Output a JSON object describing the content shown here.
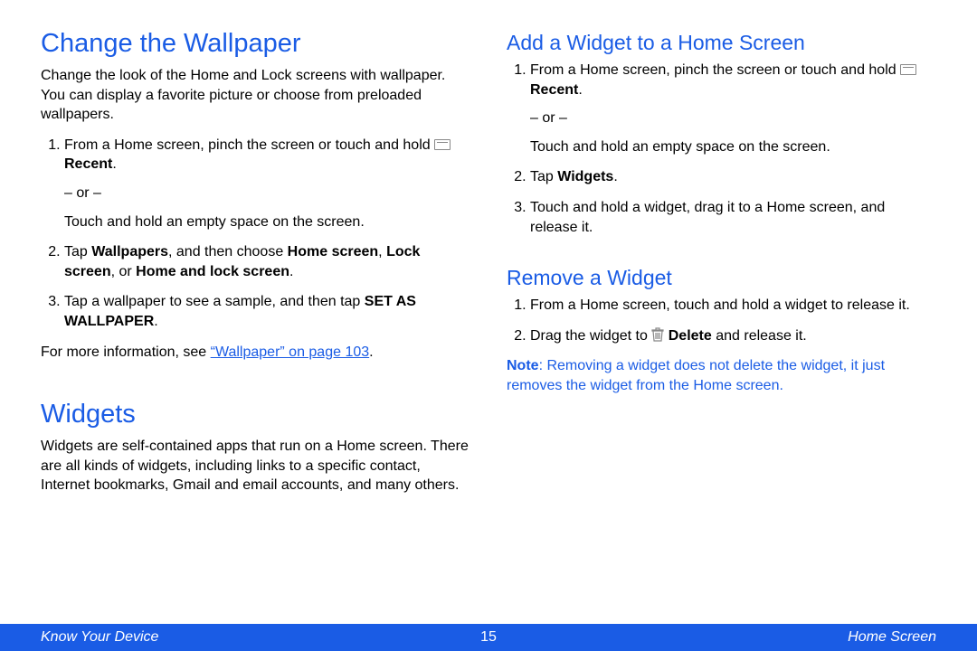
{
  "left": {
    "h_wallpaper": "Change the Wallpaper",
    "p_wallpaper": "Change the look of the Home and Lock screens with wallpaper. You can display a favorite picture or choose from preloaded wallpapers.",
    "li1_pre": "From a Home screen, pinch the screen or touch and hold ",
    "li1_bold": "Recent",
    "li1_post": ".",
    "li1_or": "– or –",
    "li1_alt": "Touch and hold an empty space on the screen.",
    "li2_pre": "Tap ",
    "li2_b1": "Wallpapers",
    "li2_mid1": ", and then choose ",
    "li2_b2": "Home screen",
    "li2_mid2": ", ",
    "li2_b3": "Lock screen",
    "li2_mid3": ", or ",
    "li2_b4": "Home and lock screen",
    "li2_post": ".",
    "li3_pre": "Tap a wallpaper to see a sample, and then tap ",
    "li3_b1": "SET AS WALLPAPER",
    "li3_post": ".",
    "moreinfo_pre": "For more information, see ",
    "moreinfo_link": "“Wallpaper” on page 103",
    "moreinfo_post": ".",
    "h_widgets": "Widgets",
    "p_widgets": "Widgets are self-contained apps that run on a Home screen. There are all kinds of widgets, including links to a specific contact, Internet bookmarks, Gmail and email accounts, and many others."
  },
  "right": {
    "h_add": "Add a Widget to a Home Screen",
    "add_li1_pre": "From a Home screen, pinch the screen or touch and hold ",
    "add_li1_bold": "Recent",
    "add_li1_post": ".",
    "add_li1_or": "– or –",
    "add_li1_alt": "Touch and hold an empty space on the screen.",
    "add_li2_pre": "Tap ",
    "add_li2_b1": "Widgets",
    "add_li2_post": ".",
    "add_li3": "Touch and hold a widget, drag it to a Home screen, and release it.",
    "h_remove": "Remove a Widget",
    "rem_li1": "From a Home screen, touch and hold a widget to release it.",
    "rem_li2_pre": "Drag the widget to ",
    "rem_li2_b1": "Delete",
    "rem_li2_post": " and release it.",
    "note_label": "Note",
    "note_colon": ": ",
    "note_text": "Removing a widget does not delete the widget, it just removes the widget from the Home screen."
  },
  "footer": {
    "left": "Know Your Device",
    "center": "15",
    "right": "Home Screen"
  }
}
